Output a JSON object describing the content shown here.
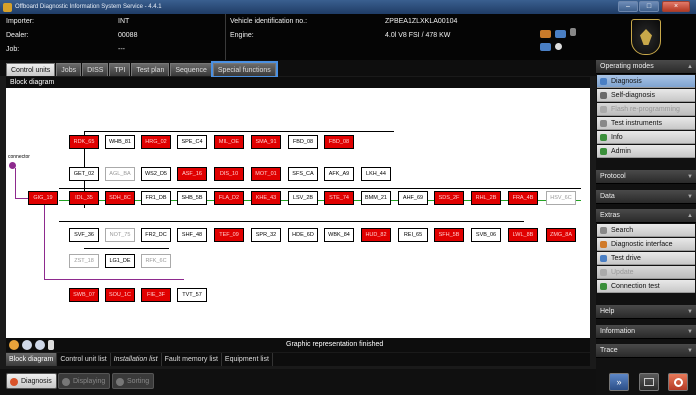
{
  "window": {
    "title": "Offboard Diagnostic Information System Service - 4.4.1",
    "controls": [
      "–",
      "□",
      "×"
    ]
  },
  "header": {
    "importer_label": "Importer:",
    "importer_value": "INT",
    "dealer_label": "Dealer:",
    "dealer_value": "00088",
    "job_label": "Job:",
    "job_value": "---",
    "vin_label": "Vehicle identification no.:",
    "vin_value": "ZPBEA1ZLXKLA00104",
    "engine_label": "Engine:",
    "engine_value": "4.0l V8 FSI / 478 KW"
  },
  "tabs": [
    "Control units",
    "Jobs",
    "DISS",
    "TPI",
    "Test plan",
    "Sequence",
    "Special functions"
  ],
  "panel": {
    "title": "Block diagram",
    "status": "Graphic representation finished",
    "connector_label": "connector"
  },
  "ecus": {
    "r1": [
      "RDK_65",
      "WHB_81",
      "HRG_02",
      "SPE_C4",
      "MIL_OE",
      "SMA_91",
      "FBD_08"
    ],
    "r2": [
      "GET_02",
      "AGL_BA",
      "WS2_D5",
      "ASF_16",
      "DIS_10",
      "MOT_01",
      "SFS_CA",
      "AFK_A9",
      "LKH_44"
    ],
    "r3": [
      "GIG_19",
      "IDL_35",
      "SDH_8C",
      "FR1_DB",
      "SHB_5B",
      "FLA_D2",
      "KHE_43",
      "LSV_2B",
      "STE_74",
      "BMM_21",
      "AHF_69",
      "SDS_2F",
      "RHL_2B",
      "FRA_4B",
      "HSV_6C"
    ],
    "r4": [
      "SVF_36",
      "NOT_75",
      "FR2_DC",
      "SHF_48",
      "TEF_09",
      "SPR_32",
      "HDE_6D",
      "WBK_84",
      "HUD_82",
      "REI_65",
      "SFH_5B",
      "SVB_06",
      "LWL_8B",
      "ZMG_8A"
    ],
    "r5": [
      "ZST_18",
      "LG1_DE",
      "RFK_6C"
    ],
    "r6": [
      "SWB_07",
      "SOU_1C",
      "FIE_3F",
      "TVT_57"
    ]
  },
  "bottom_tabs": [
    "Block diagram",
    "Control unit list",
    "Installation list",
    "Fault memory list",
    "Equipment list"
  ],
  "bottom_buttons": {
    "diagnosis": "Diagnosis",
    "displaying": "Displaying",
    "sorting": "Sorting"
  },
  "sidebar": {
    "operating_modes": "Operating modes",
    "modes": [
      "Diagnosis",
      "Self-diagnosis",
      "Flash re-programming",
      "Test instruments",
      "Info",
      "Admin"
    ],
    "protocol": "Protocol",
    "data": "Data",
    "extras": "Extras",
    "extras_items": [
      "Search",
      "Diagnostic interface",
      "Test drive",
      "Update",
      "Connection test"
    ],
    "help": "Help",
    "information": "Information",
    "trace": "Trace"
  },
  "colors": {
    "fault": "#e00000",
    "highlight": "#4a90e2",
    "bus_green": "#23a323",
    "bus_purple": "#8e2a8e"
  }
}
